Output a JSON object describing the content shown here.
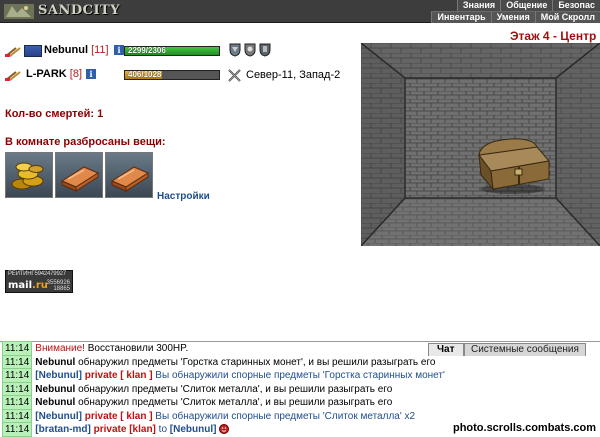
{
  "header": {
    "logo_text": "SANDCITY",
    "menu_row1": [
      "Знания",
      "Общение",
      "Безопас"
    ],
    "menu_row2": [
      "Инвентарь",
      "Умения",
      "Мой Скролл"
    ]
  },
  "players": [
    {
      "name": "Nebunul",
      "level": "[11]",
      "hp_text": "2299/2306",
      "hp_fraction": 0.997,
      "has_clan_flag": true,
      "shield_icons": [
        "shield-icon",
        "shield-icon",
        "shield-icon"
      ]
    },
    {
      "name": "L-PARK",
      "level": "[8]",
      "hp_text": "406/1028",
      "hp_fraction": 0.395,
      "has_clan_flag": false,
      "location": "Север-11, Запад-2"
    }
  ],
  "deaths_label": "Кол-во смертей: 1",
  "items_title": "В комнате разбросаны вещи:",
  "items": [
    {
      "icon": "gold-coins-icon"
    },
    {
      "icon": "copper-ingot-icon"
    },
    {
      "icon": "copper-ingot-icon"
    }
  ],
  "settings_label": "Настройки",
  "counter": {
    "top_label": "РЕЙТИНГ",
    "top_value": "5942479927",
    "logo_main": "mail",
    "logo_accent": ".ru",
    "num1": "3556926",
    "num2": "18865"
  },
  "room": {
    "title": "Этаж 4 - Центр",
    "object": "treasure-chest-icon"
  },
  "chat": {
    "tab_chat": "Чат",
    "tab_system": "Системные сообщения",
    "messages": [
      {
        "time": "11:14",
        "parts": [
          {
            "cls": "warn",
            "text": "Внимание!"
          },
          {
            "cls": "",
            "text": " Восстановили 300HP."
          }
        ]
      },
      {
        "time": "11:14",
        "parts": [
          {
            "cls": "sender",
            "text": "Nebunul"
          },
          {
            "cls": "",
            "text": " обнаружил предметы 'Горстка старинных монет', и вы решили разыграть его"
          }
        ]
      },
      {
        "time": "11:14",
        "parts": [
          {
            "cls": "sender-blue",
            "text": "[Nebunul]"
          },
          {
            "cls": "private",
            "text": " private [ klan ]"
          },
          {
            "cls": "note-blue",
            "text": " Вы обнаружили спорные предметы 'Горстка старинных монет'"
          }
        ]
      },
      {
        "time": "11:14",
        "parts": [
          {
            "cls": "sender",
            "text": "Nebunul"
          },
          {
            "cls": "",
            "text": " обнаружил предметы 'Слиток металла', и вы решили разыграть его"
          }
        ]
      },
      {
        "time": "11:14",
        "parts": [
          {
            "cls": "sender",
            "text": "Nebunul"
          },
          {
            "cls": "",
            "text": " обнаружил предметы 'Слиток металла', и вы решили разыграть его"
          }
        ]
      },
      {
        "time": "11:14",
        "parts": [
          {
            "cls": "sender-blue",
            "text": "[Nebunul]"
          },
          {
            "cls": "private",
            "text": " private [ klan ]"
          },
          {
            "cls": "note-blue",
            "text": " Вы обнаружили спорные предметы 'Слиток металла' x2"
          }
        ]
      },
      {
        "time": "11:14",
        "parts": [
          {
            "cls": "sender-blue",
            "text": "[bratan-md]"
          },
          {
            "cls": "private",
            "text": " private [klan]"
          },
          {
            "cls": "to-text",
            "text": " to "
          },
          {
            "cls": "sender-blue",
            "text": "[Nebunul]"
          }
        ],
        "smiley": true
      }
    ]
  },
  "watermark": "photo.scrolls.combats.com"
}
